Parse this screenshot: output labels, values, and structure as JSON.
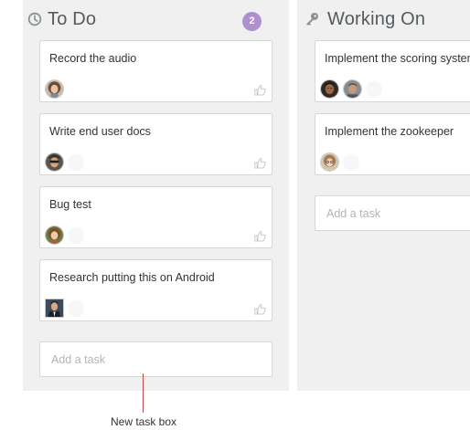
{
  "columns": [
    {
      "title": "To Do",
      "icon": "clock-icon",
      "count": "2",
      "badge_color": "#b08fce",
      "cards": [
        {
          "title": "Record the audio",
          "avatars": [
            "woman-curly"
          ]
        },
        {
          "title": "Write end user docs",
          "avatars": [
            "man-sunglasses"
          ]
        },
        {
          "title": "Bug test",
          "avatars": [
            "woman-smiling"
          ]
        },
        {
          "title": "Research putting this on Android",
          "avatars": [
            "man-suit"
          ]
        }
      ],
      "add_placeholder": "Add a task"
    },
    {
      "title": "Working On",
      "icon": "key-icon",
      "cards": [
        {
          "title": "Implement the scoring system",
          "avatars": [
            "man-dark",
            "man-gray"
          ]
        },
        {
          "title": "Implement the zookeeper",
          "avatars": [
            "woman-glasses"
          ]
        }
      ],
      "add_placeholder": "Add a task"
    }
  ],
  "annotation": {
    "label": "New task box",
    "line_color": "#b94a4a"
  },
  "colors": {
    "column_bg": "#eff0ef",
    "card_border": "#d5d8d6",
    "title_text": "#555a5e"
  }
}
